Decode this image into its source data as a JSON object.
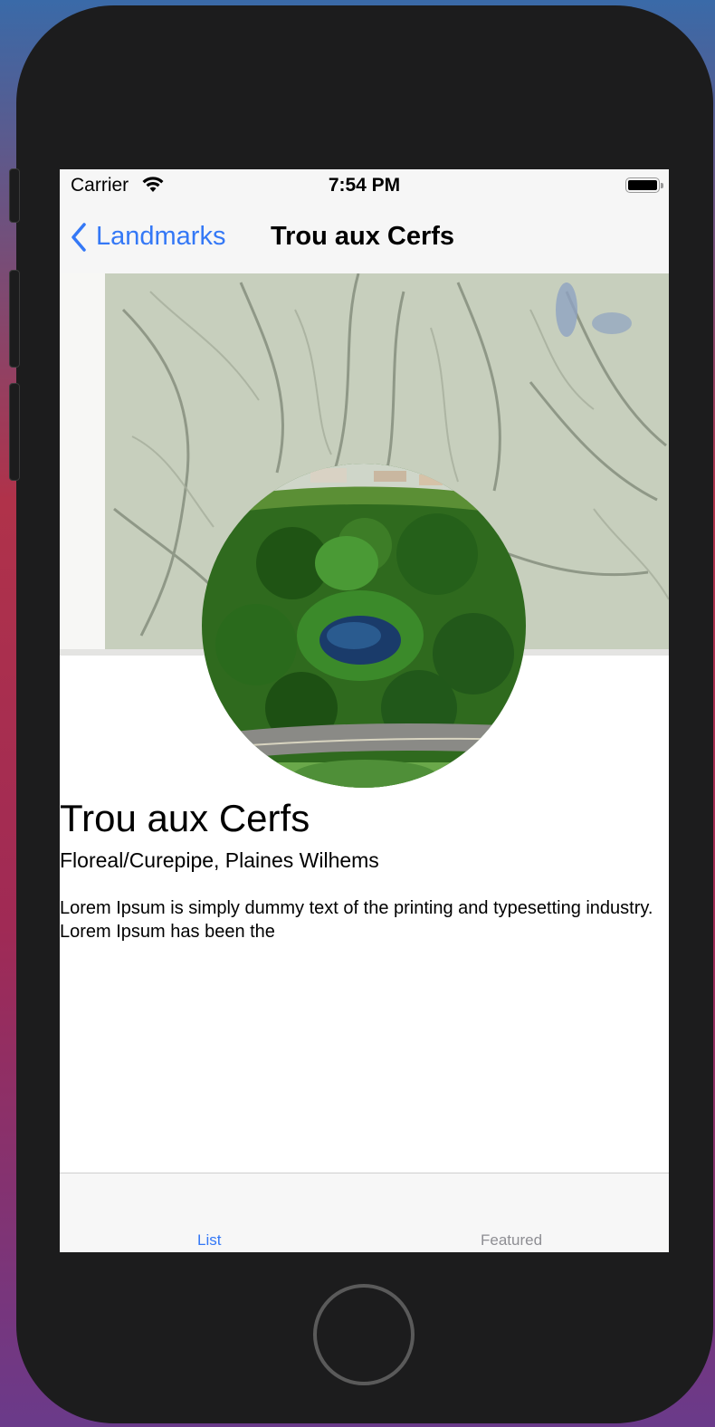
{
  "status_bar": {
    "carrier": "Carrier",
    "time": "7:54 PM",
    "icons": [
      "wifi-icon",
      "battery-icon"
    ]
  },
  "nav": {
    "back_label": "Landmarks",
    "title": "Trou aux Cerfs"
  },
  "landmark": {
    "name": "Trou aux Cerfs",
    "location": "Floreal/Curepipe, Plaines Wilhems",
    "description": "Lorem Ipsum is simply dummy text of the printing and typesetting industry. Lorem Ipsum has been the"
  },
  "tabs": [
    {
      "label": "List",
      "selected": true
    },
    {
      "label": "Featured",
      "selected": false
    }
  ],
  "colors": {
    "accent": "#3478f6",
    "inactive_tab": "#8e8e93"
  }
}
